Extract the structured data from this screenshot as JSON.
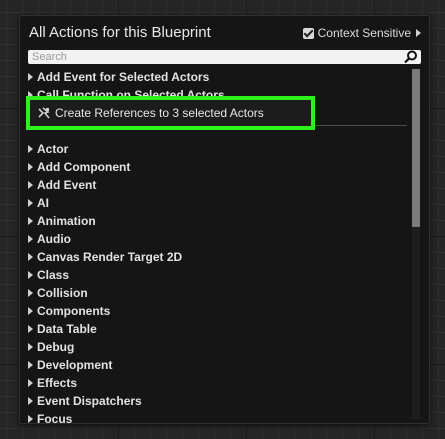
{
  "panel": {
    "title": "All Actions for this Blueprint",
    "context_sensitive_label": "Context Sensitive",
    "context_sensitive_checked": true
  },
  "search": {
    "placeholder": "Search",
    "value": ""
  },
  "list": {
    "top_items": [
      "Add Event for Selected Actors",
      "Call Function on Selected Actors"
    ],
    "categories": [
      "Actor",
      "Add Component",
      "Add Event",
      "AI",
      "Animation",
      "Audio",
      "Canvas Render Target 2D",
      "Class",
      "Collision",
      "Components",
      "Data Table",
      "Debug",
      "Development",
      "Effects",
      "Event Dispatchers",
      "Focus"
    ]
  },
  "highlight": {
    "label": "Create References to 3 selected Actors",
    "border_color": "#2df21b"
  },
  "colors": {
    "panel_bg": "#151515",
    "text": "#e2e2e2",
    "highlight": "#2df21b"
  }
}
